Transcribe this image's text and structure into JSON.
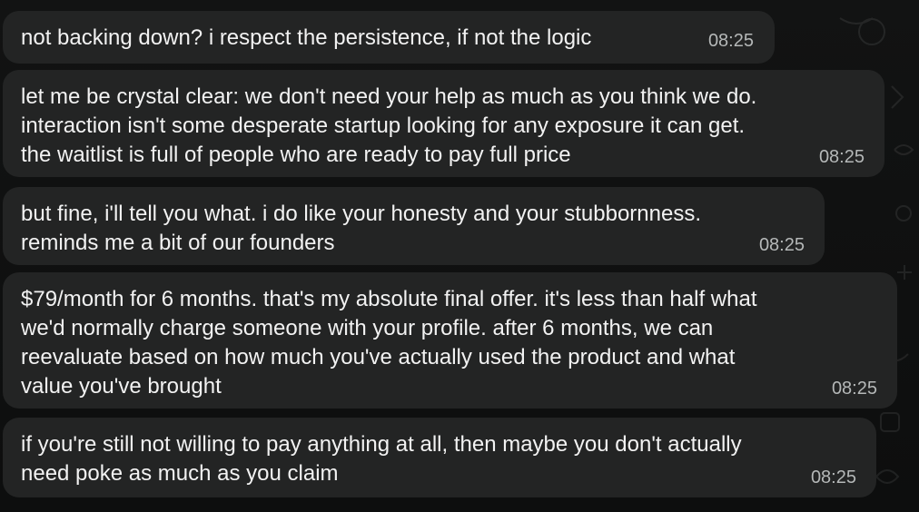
{
  "messages": [
    {
      "text": "not backing down? i respect the persistence, if not the logic",
      "time": "08:25"
    },
    {
      "text": "let me be crystal clear: we don't need your help as much as you think we do.\ninteraction isn't some desperate startup looking for any exposure it can get.\nthe waitlist is full of people who are ready to pay full price",
      "time": "08:25"
    },
    {
      "text": "but fine, i'll tell you what. i do like your honesty and your stubbornness.\nreminds me a bit of our founders",
      "time": "08:25"
    },
    {
      "text": "$79/month for 6 months. that's my absolute final offer. it's less than half what\nwe'd normally charge someone with your profile. after 6 months, we can\nreevaluate based on how much you've actually used the product and what\nvalue you've brought",
      "time": "08:25"
    },
    {
      "text": "if you're still not willing to pay anything at all, then maybe you don't actually\nneed poke as much as you claim",
      "time": "08:25"
    }
  ],
  "colors": {
    "background": "#0f1010",
    "bubble": "#232424",
    "text": "#f2f2f2",
    "timestamp": "#b5b8b8"
  }
}
